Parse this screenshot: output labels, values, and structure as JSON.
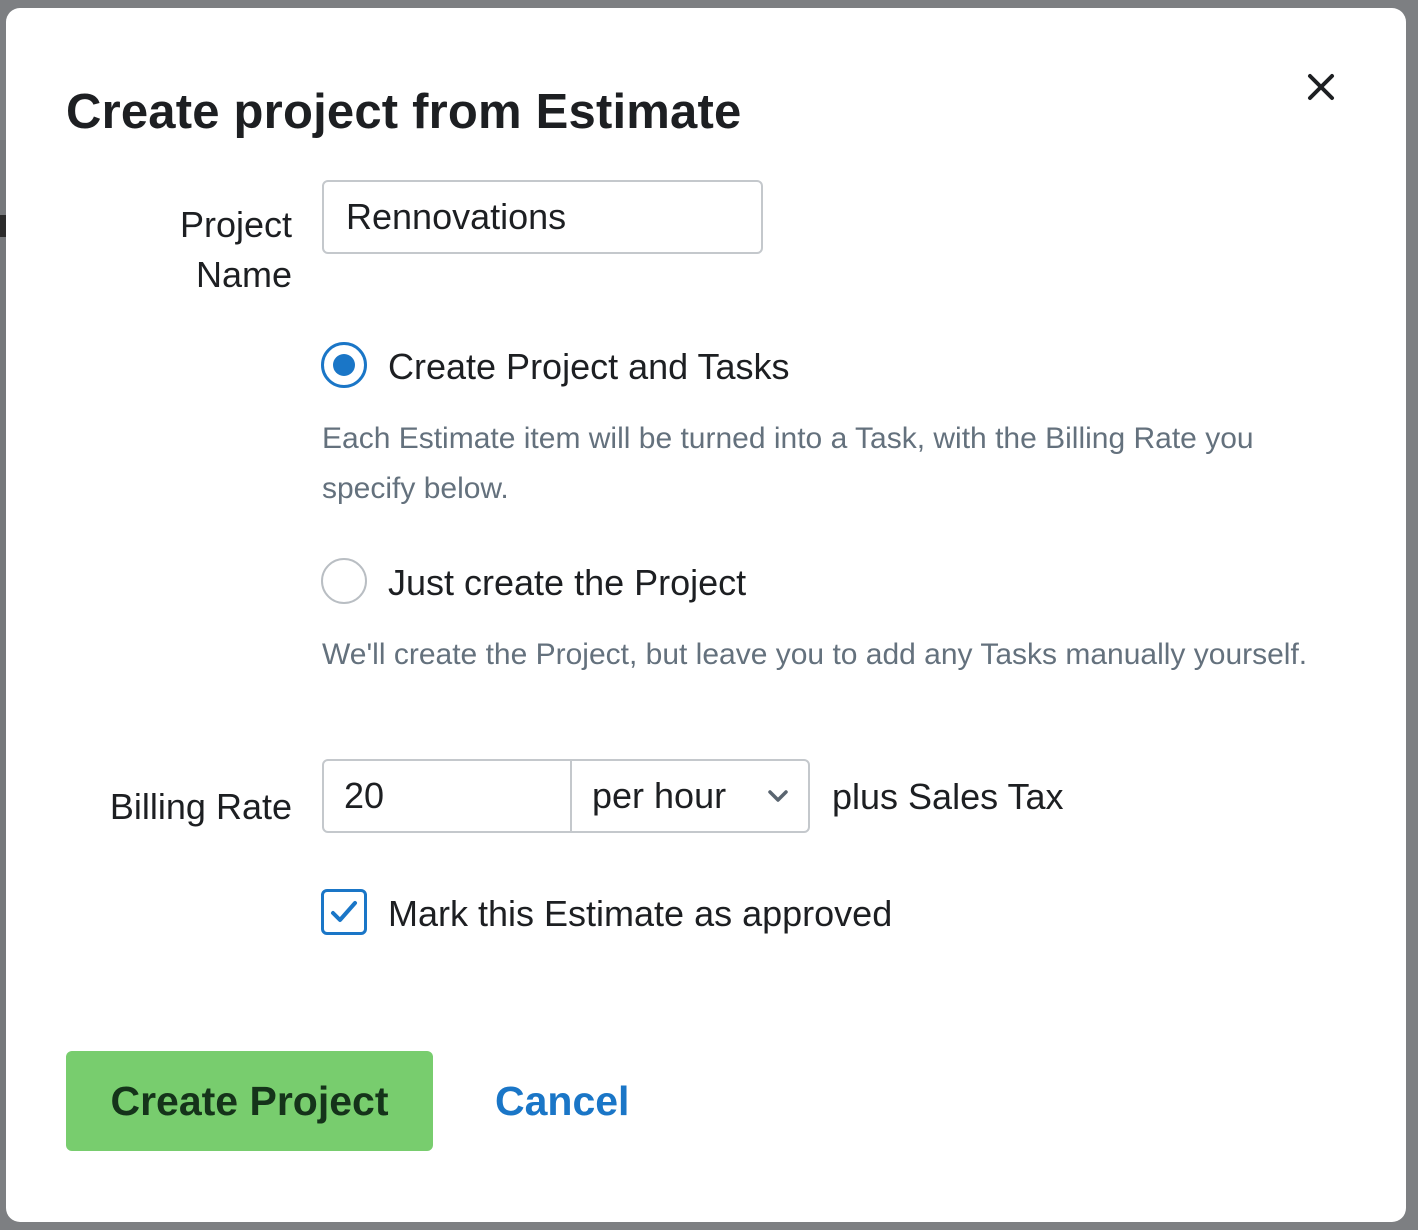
{
  "dialog": {
    "title": "Create project from Estimate",
    "close_icon": "close-icon"
  },
  "project_name": {
    "label": "Project Name",
    "value": "Rennovations"
  },
  "options": [
    {
      "label": "Create Project and Tasks",
      "description": "Each Estimate item will be turned into a Task, with the Billing Rate you specify below.",
      "selected": true
    },
    {
      "label": "Just create the Project",
      "description": "We'll create the Project, but leave you to add any Tasks manually yourself.",
      "selected": false
    }
  ],
  "billing": {
    "label": "Billing Rate",
    "rate_value": "20",
    "unit": "per hour",
    "unit_icon": "chevron-down-icon",
    "suffix": "plus Sales Tax"
  },
  "approve": {
    "label": "Mark this Estimate as approved",
    "checked": true
  },
  "actions": {
    "primary": "Create Project",
    "cancel": "Cancel"
  },
  "colors": {
    "accent": "#1a76c7",
    "primary_button": "#78cd6e",
    "description_text": "#64717d"
  }
}
